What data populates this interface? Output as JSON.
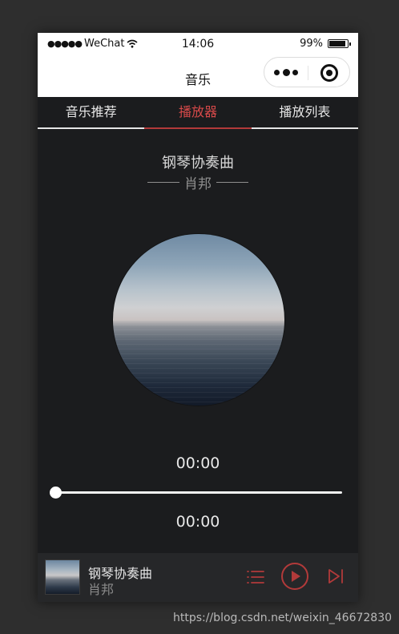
{
  "colors": {
    "accent": "#d84a4a",
    "background": "#1b1c1e",
    "player_bar": "#262729",
    "statusbar": "#ffffff"
  },
  "statusbar": {
    "carrier": "WeChat",
    "time": "14:06",
    "battery": "99%",
    "battery_level": 0.99
  },
  "navbar": {
    "title": "音乐",
    "more_icon": "ellipsis-icon",
    "close_icon": "target-circle-icon"
  },
  "tabs": [
    {
      "label": "音乐推荐",
      "active": false
    },
    {
      "label": "播放器",
      "active": true
    },
    {
      "label": "播放列表",
      "active": false
    }
  ],
  "now_playing": {
    "title": "钢琴协奏曲",
    "artist": "肖邦",
    "current_time": "00:00",
    "total_time": "00:00",
    "progress": 0
  },
  "mini_player": {
    "title": "钢琴协奏曲",
    "artist": "肖邦",
    "icons": [
      "playlist-icon",
      "play-icon",
      "next-track-icon"
    ]
  },
  "watermark": "https://blog.csdn.net/weixin_46672830"
}
